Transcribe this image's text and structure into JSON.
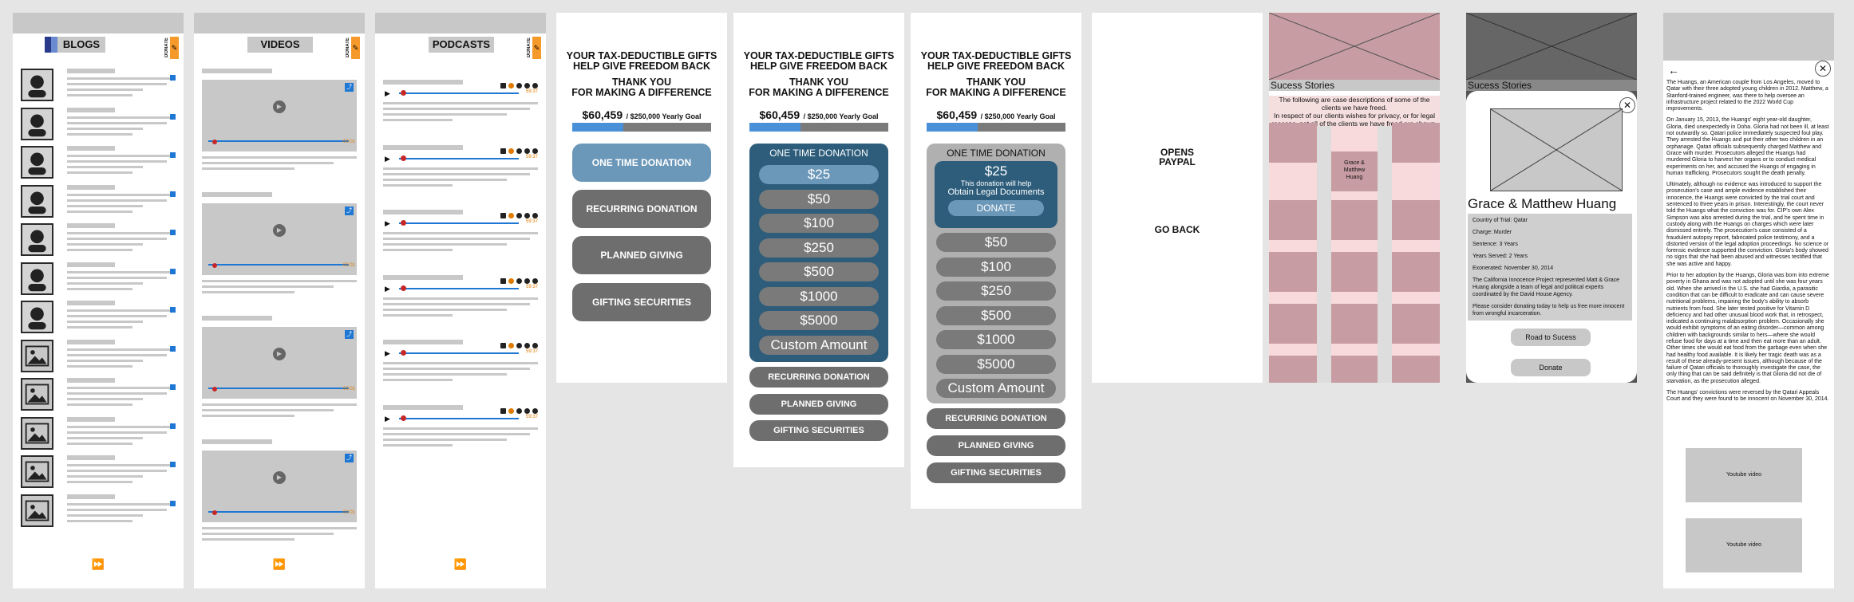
{
  "blogs": {
    "title": "BLOGS",
    "donate_tab": "DONATE",
    "donate_icon": "sticky-note-icon",
    "rows": 12
  },
  "videos": {
    "title": "VIDEOS",
    "donate_tab": "DONATE",
    "time": "00:01",
    "rows": 4
  },
  "podcasts": {
    "title": "PODCASTS",
    "donate_tab": "DONATE",
    "time": "59:37",
    "rows": 6
  },
  "donate_screen": {
    "heading_1": "YOUR TAX-DEDUCTIBLE GIFTS",
    "heading_2": "HELP GIVE FREEDOM BACK",
    "heading_3": "THANK YOU",
    "heading_4": "FOR MAKING A DIFFERENCE",
    "amount": "$60,459",
    "goal": "/ $250,000 Yearly Goal",
    "progress": 0.24,
    "one_time": "ONE TIME DONATION",
    "recurring": "RECURRING DONATION",
    "planned": "PLANNED GIVING",
    "gifting": "GIFTING SECURITIES"
  },
  "amounts": [
    "$25",
    "$50",
    "$100",
    "$250",
    "$500",
    "$1000",
    "$5000",
    "Custom Amount"
  ],
  "selected_detail": {
    "amount": "$25",
    "line_1": "This donation will help",
    "line_2": "Obtain Legal Documents",
    "donate": "DONATE"
  },
  "paypal": {
    "opens": "OPENS",
    "paypal": "PAYPAL",
    "go_back": "GO BACK"
  },
  "success": {
    "title": "Sucess Stories",
    "intro_1": "The following are case descriptions of some of the",
    "intro_2": "clients we have freed.",
    "intro_3": "In respect of our clients wishes for privacy, or for legal",
    "intro_4": "reasons, not all of the clients we have freed are shown.",
    "tile_label_1": "Grace &",
    "tile_label_2": "Matthew",
    "tile_label_3": "Huang"
  },
  "modal": {
    "name": "Grace & Matthew Huang",
    "country": "Country of Trial: Qatar",
    "charge": "Charge: Murder",
    "sentence": "Sentence: 3 Years",
    "served": "Years Served: 2 Years",
    "exonerated": "Exonerated: November 30, 2014",
    "project": "The California Innocence Project represented Matt & Grace Huang alongside a team of legal and political experts coordinated by the David House Agency.",
    "please": "Please consider donating today to help us free more innocent from wrongful incarceration.",
    "road": "Road to Sucess",
    "donate": "Donate"
  },
  "story": {
    "p1": "The Huangs, an American couple from Los Angeles, moved to Qatar with their three adopted young children in 2012. Matthew, a Stanford-trained engineer, was there to help oversee an infrastructure project related to the 2022 World Cup improvements.",
    "p2": "On January 15, 2013, the Huangs' eight year-old daughter, Gloria, died unexpectedly in Doha. Gloria had not been ill, at least not outwardly so. Qatari police immediately suspected foul play. They arrested the Huangs and put their other two children in an orphanage. Qatari officials subsequently charged Matthew and Grace with murder. Prosecutors alleged the Huangs had murdered Gloria to harvest her organs or to conduct medical experiments on her, and accused the Huangs of engaging in human trafficking. Prosecutors sought the death penalty.",
    "p3": "Ultimately, although no evidence was introduced to support the prosecution's case and ample evidence established their innocence, the Huangs were convicted by the trial court and sentenced to three years in prison. Interestingly, the court never told the Huangs what the conviction was for. CIP's own Alex Simpson was also arrested during the trial, and he spent time in custody along with the Huangs on charges which were later dismissed entirely. The prosecution's case consisted of a fraudulent autopsy report, fabricated police testimony, and a distorted version of the legal adoption proceedings. No science or forensic evidence supported the conviction. Gloria's body showed no signs that she had been abused and witnesses testified that she was active and happy.",
    "p4": "Prior to her adoption by the Huangs, Gloria was born into extreme poverty in Ghana and was not adopted until she was four years old. When she arrived in the U.S. she had Giardia, a parasitic condition that can be difficult to eradicate and can cause severe nutritional problems, impairing the body's ability to absorb nutrients from food. She later tested positive for Vitamin D deficiency and had other unusual blood work that, in retrospect, indicated a continuing malabsorption problem. Occasionally she would exhibit symptoms of an eating disorder—common among children with backgrounds similar to hers—where she would refuse food for days at a time and then eat more than an adult. Other times she would eat food from the garbage even when she had healthy food available. It is likely her tragic death was as a result of these already-present issues, although because of the failure of Qatari officials to thoroughly investigate the case, the only thing that can be said definitely is that Gloria did not die of starvation, as the prosecution alleged.",
    "p5": "The Huangs' convictions were reversed by the Qatari Appeals Court and they were found to be innocent on November 30, 2014.",
    "youtube": "Youtube video"
  },
  "colors": {
    "blue": "#1f77d4",
    "orange": "#f59a2a",
    "panel": "#2d5d7b",
    "pink": "#c79ca2"
  }
}
